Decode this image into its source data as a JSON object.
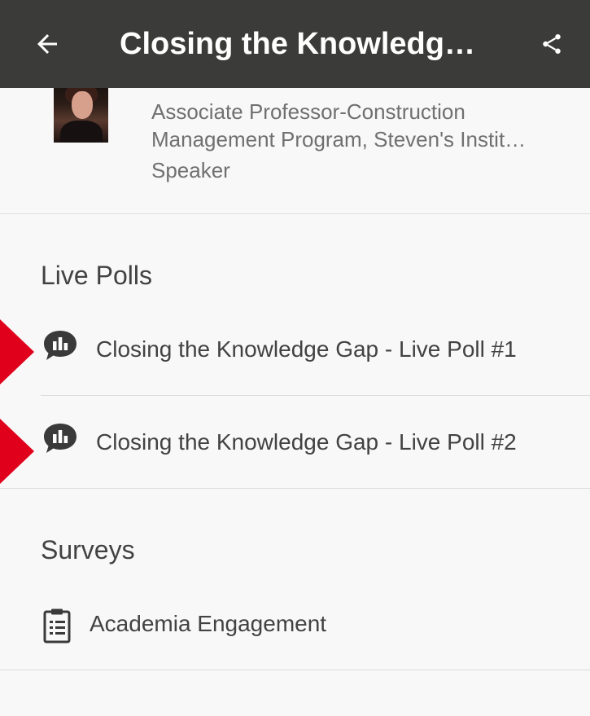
{
  "appbar": {
    "title": "Closing the Knowledge…",
    "back_icon": "arrow-left-icon",
    "share_icon": "share-icon",
    "background": "#3b3b39"
  },
  "speaker": {
    "role_line1": "Associate Professor-Construction",
    "role_line2": "Management Program, Steven's Instit…",
    "label": "Speaker"
  },
  "live_polls": {
    "heading": "Live Polls",
    "items": [
      {
        "label": "Closing the Knowledge Gap - Live Poll #1",
        "icon": "poll-chat-icon"
      },
      {
        "label": "Closing the Knowledge Gap - Live Poll #2",
        "icon": "poll-chat-icon"
      }
    ]
  },
  "surveys": {
    "heading": "Surveys",
    "items": [
      {
        "label": "Academia Engagement",
        "icon": "clipboard-icon"
      }
    ]
  },
  "colors": {
    "marker": "#e0001b",
    "text": "#424242",
    "secondary_text": "#707070"
  }
}
